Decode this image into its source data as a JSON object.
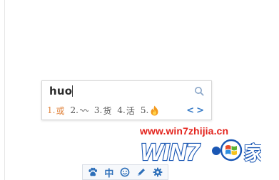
{
  "ime": {
    "composition": "huo",
    "candidates": [
      {
        "number": "1.",
        "word": "或",
        "active": true
      },
      {
        "number": "2.",
        "word": "",
        "icon": "wavy-symbol-icon"
      },
      {
        "number": "3.",
        "word": "货"
      },
      {
        "number": "4.",
        "word": "活"
      },
      {
        "number": "5.",
        "word": "",
        "icon": "flame-emoji-icon"
      }
    ],
    "pager": {
      "prev": "<",
      "next": ">"
    },
    "icons": {
      "search": "search-icon"
    }
  },
  "watermark": {
    "url": "www.win7zhijia.cn",
    "logo_text": "WIN7",
    "logo_suffix": "家"
  },
  "status_bar": {
    "items": [
      {
        "name": "paw-logo-icon",
        "label": ""
      },
      {
        "name": "chinese-mode",
        "label": "中"
      },
      {
        "name": "emoji-icon",
        "label": ""
      },
      {
        "name": "pen-icon",
        "label": ""
      },
      {
        "name": "settings-icon",
        "label": ""
      }
    ]
  },
  "colors": {
    "active_candidate": "#e0823a",
    "accent_blue": "#3a7dc8",
    "watermark_red": "#e3231c",
    "logo_blue": "#1a57b4"
  }
}
